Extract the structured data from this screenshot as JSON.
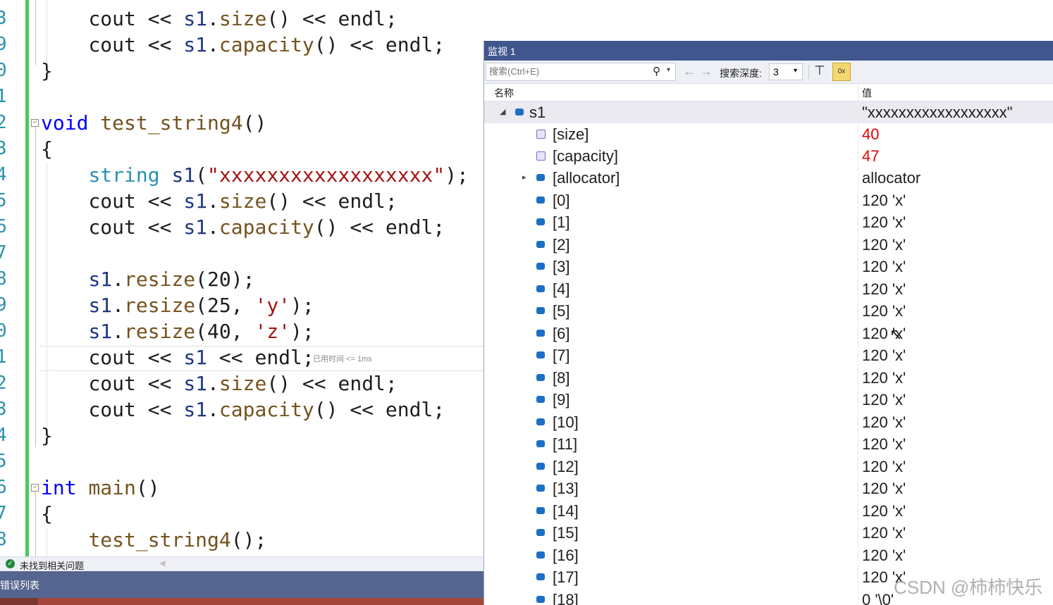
{
  "editor": {
    "line_numbers": [
      "3",
      "9",
      "0",
      "1",
      "2",
      "3",
      "4",
      "5",
      "6",
      "7",
      "8",
      "9",
      "0",
      "1",
      "2",
      "3",
      "4",
      "5",
      "6",
      "7",
      "8"
    ],
    "hint": "已用时间 <= 1ms"
  },
  "status": {
    "text": "未找到相关问题"
  },
  "error_list": {
    "tab": "错误列表"
  },
  "watch": {
    "title": "监视 1",
    "search_placeholder": "搜索(Ctrl+E)",
    "depth_label": "搜索深度:",
    "depth_value": "3",
    "col_name": "名称",
    "col_value": "值",
    "rows": [
      {
        "name": "s1",
        "value": "\"xxxxxxxxxxxxxxxxxx\""
      },
      {
        "name": "[size]",
        "value": "40"
      },
      {
        "name": "[capacity]",
        "value": "47"
      },
      {
        "name": "[allocator]",
        "value": "allocator"
      },
      {
        "name": "[0]",
        "value": "120 'x'"
      },
      {
        "name": "[1]",
        "value": "120 'x'"
      },
      {
        "name": "[2]",
        "value": "120 'x'"
      },
      {
        "name": "[3]",
        "value": "120 'x'"
      },
      {
        "name": "[4]",
        "value": "120 'x'"
      },
      {
        "name": "[5]",
        "value": "120 'x'"
      },
      {
        "name": "[6]",
        "value": "120 'x'"
      },
      {
        "name": "[7]",
        "value": "120 'x'"
      },
      {
        "name": "[8]",
        "value": "120 'x'"
      },
      {
        "name": "[9]",
        "value": "120 'x'"
      },
      {
        "name": "[10]",
        "value": "120 'x'"
      },
      {
        "name": "[11]",
        "value": "120 'x'"
      },
      {
        "name": "[12]",
        "value": "120 'x'"
      },
      {
        "name": "[13]",
        "value": "120 'x'"
      },
      {
        "name": "[14]",
        "value": "120 'x'"
      },
      {
        "name": "[15]",
        "value": "120 'x'"
      },
      {
        "name": "[16]",
        "value": "120 'x'"
      },
      {
        "name": "[17]",
        "value": "120 'x'"
      },
      {
        "name": "[18]",
        "value": "0 '\\0'"
      }
    ]
  },
  "code": {
    "l1": {
      "a": "cout",
      "b": "<<",
      "c": "s1",
      "d": ".",
      "e": "size",
      "f": "()",
      "g": "<<",
      "h": "endl",
      "i": ";"
    },
    "l2": {
      "a": "cout",
      "b": "<<",
      "c": "s1",
      "d": ".",
      "e": "capacity",
      "f": "()",
      "g": "<<",
      "h": "endl",
      "i": ";"
    },
    "l3": {
      "a": "}"
    },
    "l5": {
      "a": "void",
      "b": "test_string4",
      "c": "()"
    },
    "l6": {
      "a": "{"
    },
    "l7": {
      "a": "string",
      "b": "s1",
      "c": "(",
      "d": "\"xxxxxxxxxxxxxxxxxx\"",
      "e": ");"
    },
    "l8": {
      "a": "cout",
      "b": "<<",
      "c": "s1",
      "d": ".",
      "e": "size",
      "f": "()",
      "g": "<<",
      "h": "endl",
      "i": ";"
    },
    "l9": {
      "a": "cout",
      "b": "<<",
      "c": "s1",
      "d": ".",
      "e": "capacity",
      "f": "()",
      "g": "<<",
      "h": "endl",
      "i": ";"
    },
    "l11": {
      "a": "s1",
      "b": ".",
      "c": "resize",
      "d": "(20);"
    },
    "l12": {
      "a": "s1",
      "b": ".",
      "c": "resize",
      "d": "(25, ",
      "e": "'y'",
      "f": ");"
    },
    "l13": {
      "a": "s1",
      "b": ".",
      "c": "resize",
      "d": "(40, ",
      "e": "'z'",
      "f": ");"
    },
    "l14": {
      "a": "cout",
      "b": "<<",
      "c": "s1",
      "g": "<<",
      "h": "endl",
      "i": ";"
    },
    "l15": {
      "a": "cout",
      "b": "<<",
      "c": "s1",
      "d": ".",
      "e": "size",
      "f": "()",
      "g": "<<",
      "h": "endl",
      "i": ";"
    },
    "l16": {
      "a": "cout",
      "b": "<<",
      "c": "s1",
      "d": ".",
      "e": "capacity",
      "f": "()",
      "g": "<<",
      "h": "endl",
      "i": ";"
    },
    "l17": {
      "a": "}"
    },
    "l19": {
      "a": "int",
      "b": "main",
      "c": "()"
    },
    "l20": {
      "a": "{"
    },
    "l21": {
      "a": "test_string4",
      "b": "();"
    }
  },
  "watermark": "CSDN @柿柿快乐",
  "colors": {
    "title_bar": "#40568d",
    "error_bar": "#56658f",
    "changed_value": "#e60000",
    "keyword": "#0000ff",
    "type": "#2b91af",
    "function": "#74531f",
    "string": "#a31515"
  }
}
